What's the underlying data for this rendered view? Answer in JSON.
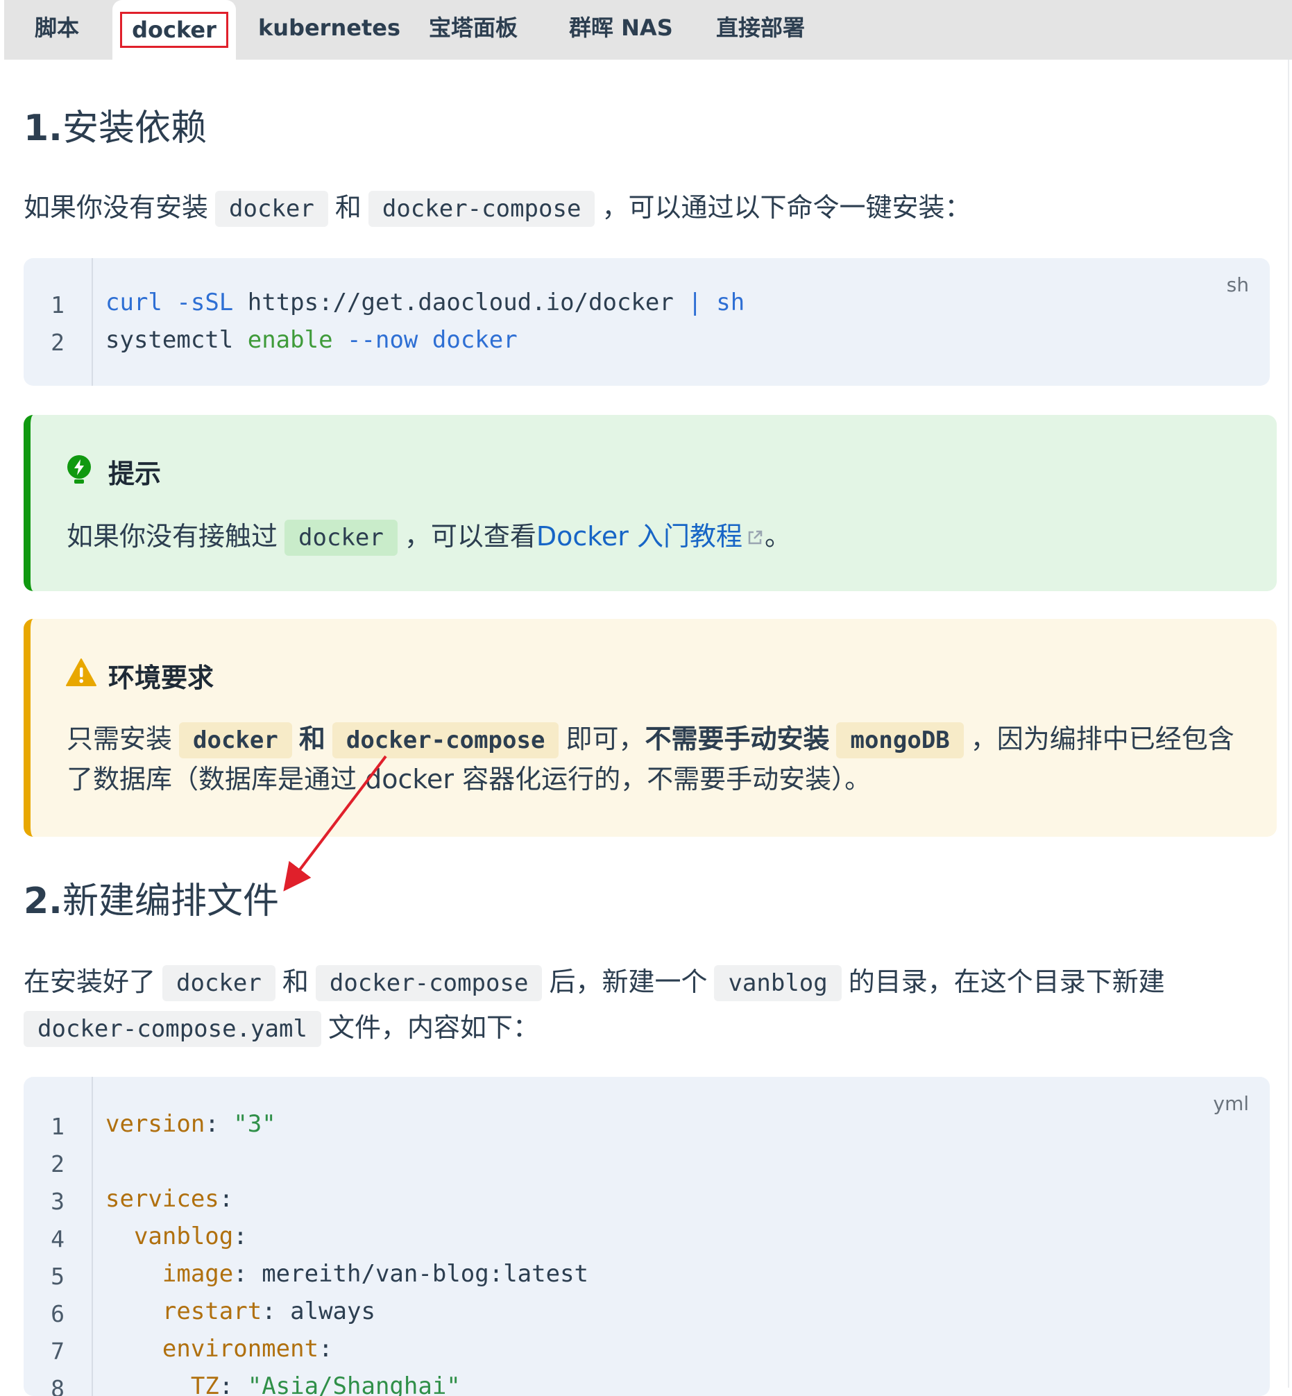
{
  "tabs": [
    {
      "label": "脚本"
    },
    {
      "label": "docker"
    },
    {
      "label": "kubernetes"
    },
    {
      "label": "宝塔面板"
    },
    {
      "label": "群晖 NAS"
    },
    {
      "label": "直接部署"
    }
  ],
  "section1": {
    "num": "1.",
    "title": "安装依赖",
    "intro": {
      "t1": "如果你没有安装",
      "c1": "docker",
      "t2": "和",
      "c2": "docker-compose",
      "t3": "，可以通过以下命令一键安装："
    },
    "code": {
      "lang": "sh",
      "line_numbers": [
        "1",
        "2"
      ],
      "l1": {
        "a": "curl",
        "b": "-sSL",
        "c": "https://get.daocloud.io/docker",
        "d": "|",
        "e": "sh"
      },
      "l2": {
        "a": "systemctl",
        "b": "enable",
        "c": "--now",
        "d": "docker"
      }
    }
  },
  "tip": {
    "title": "提示",
    "t1": "如果你没有接触过",
    "c1": "docker",
    "t2": "，可以查看",
    "link": "Docker 入门教程",
    "t3": "。"
  },
  "warning": {
    "title": "环境要求",
    "t1": "只需安装",
    "c1": "docker",
    "t2": "和",
    "c2": "docker-compose",
    "t3": "即可，",
    "t4": "不需要手动安装",
    "c3": "mongoDB",
    "t5": "，因为编排中已经包含",
    "t6": "了数据库（数据库是通过 docker 容器化运行的，不需要手动安装）。"
  },
  "section2": {
    "num": "2.",
    "title": "新建编排文件",
    "intro": {
      "t1": "在安装好了",
      "c1": "docker",
      "t2": "和",
      "c2": "docker-compose",
      "t3": "后，新建一个",
      "c3": "vanblog",
      "t4": "的目录，在这个目录下新建",
      "c4": "docker-compose.yaml",
      "t5": "文件，内容如下："
    },
    "code": {
      "lang": "yml",
      "line_numbers": [
        "1",
        "2",
        "3",
        "4",
        "5",
        "6",
        "7",
        "8"
      ],
      "l1": {
        "k": "version",
        "sep": ": ",
        "v": "\"3\""
      },
      "l3": {
        "k": "services",
        "sep": ":"
      },
      "l4": {
        "k": "vanblog",
        "sep": ":"
      },
      "l5": {
        "k": "image",
        "sep": ": ",
        "v": "mereith/van-blog:latest"
      },
      "l6": {
        "k": "restart",
        "sep": ": ",
        "v": "always"
      },
      "l7": {
        "k": "environment",
        "sep": ":"
      },
      "l8": {
        "k": "TZ",
        "sep": ": ",
        "v": "\"Asia/Shanghai\""
      }
    }
  },
  "colors": {
    "tab_bg": "#e4e4e4",
    "active_outline": "#e0202b",
    "code_bg": "#edf2f9",
    "tip_bg": "#e3f5e5",
    "tip_border": "#109910",
    "warn_bg": "#fdf7e6",
    "warn_border": "#e8a700",
    "link": "#1765c6",
    "annotation_arrow": "#e0202b"
  },
  "icons": {
    "tip": "lightbulb-icon",
    "warning": "warning-triangle-icon",
    "external_link": "external-link-icon"
  }
}
